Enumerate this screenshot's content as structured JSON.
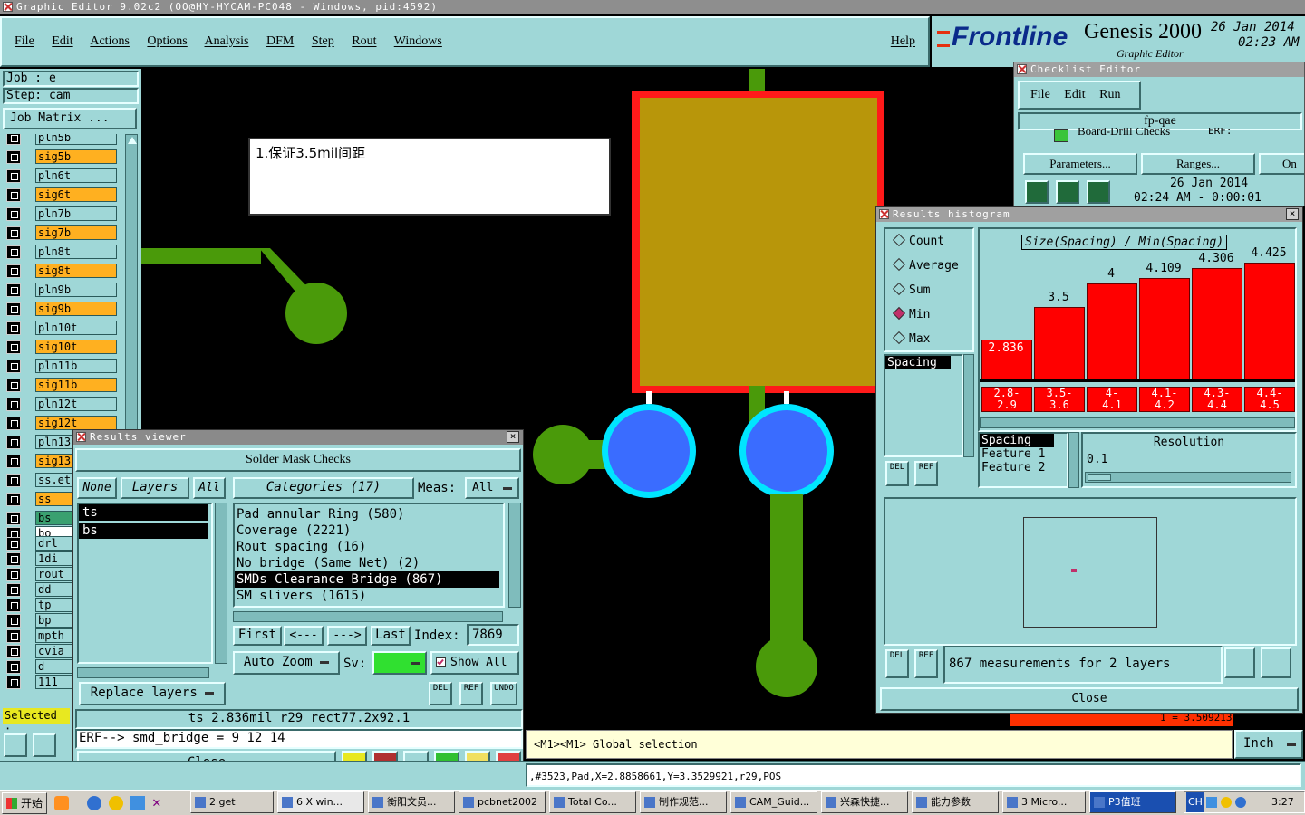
{
  "app": {
    "title": "Graphic Editor 9.02c2 (OO@HY-HYCAM-PC048 - Windows, pid:4592)",
    "brand": "Frontline",
    "product": "Genesis 2000",
    "subtitle": "Graphic Editor",
    "date": "26 Jan 2014",
    "time": "02:23 AM"
  },
  "menu": [
    "File",
    "Edit",
    "Actions",
    "Options",
    "Analysis",
    "DFM",
    "Step",
    "Rout",
    "Windows"
  ],
  "help_label": "Help",
  "job": {
    "job": "Job : e",
    "step": "Step: cam",
    "matrix": "Job Matrix ..."
  },
  "layers": [
    {
      "name": "pln5b",
      "sig": false
    },
    {
      "name": "sig5b",
      "sig": true
    },
    {
      "name": "pln6t",
      "sig": false
    },
    {
      "name": "sig6t",
      "sig": true
    },
    {
      "name": "pln7b",
      "sig": false
    },
    {
      "name": "sig7b",
      "sig": true
    },
    {
      "name": "pln8t",
      "sig": false
    },
    {
      "name": "sig8t",
      "sig": true
    },
    {
      "name": "pln9b",
      "sig": false
    },
    {
      "name": "sig9b",
      "sig": true
    },
    {
      "name": "pln10t",
      "sig": false
    },
    {
      "name": "sig10t",
      "sig": true
    },
    {
      "name": "pln11b",
      "sig": false
    },
    {
      "name": "sig11b",
      "sig": true
    },
    {
      "name": "pln12t",
      "sig": false
    },
    {
      "name": "sig12t",
      "sig": true
    },
    {
      "name": "pln13",
      "sig": false
    },
    {
      "name": "sig13",
      "sig": true
    },
    {
      "name": "ss.et",
      "sig": false
    },
    {
      "name": "ss",
      "sig": true
    },
    {
      "name": "bs",
      "sig": false,
      "green": true
    },
    {
      "name": "bo",
      "sig": false,
      "white": true
    },
    {
      "name": "drl",
      "sig": false
    },
    {
      "name": "1di",
      "sig": false
    },
    {
      "name": "rout",
      "sig": false
    },
    {
      "name": "dd",
      "sig": false
    },
    {
      "name": "tp",
      "sig": false
    },
    {
      "name": "bp",
      "sig": false
    },
    {
      "name": "mpth",
      "sig": false
    },
    {
      "name": "cvia",
      "sig": false
    },
    {
      "name": "d",
      "sig": false
    },
    {
      "name": "111",
      "sig": false
    }
  ],
  "selected_label": "Selected :",
  "annotation": "1.保证3.5mil间距",
  "results_viewer": {
    "title": "Results viewer",
    "header": "Solder Mask Checks",
    "none": "None",
    "layers": "Layers",
    "all": "All",
    "categories": "Categories (17)",
    "meas_label": "Meas:",
    "meas_value": "All",
    "layer_list": [
      "ts",
      "bs"
    ],
    "category_list": [
      "Pad annular Ring (580)",
      "Coverage (2221)",
      "Rout spacing (16)",
      "No bridge (Same Net) (2)",
      "SMDs Clearance Bridge (867)",
      "SM slivers (1615)"
    ],
    "selected_category": 4,
    "first": "First",
    "prev": "<---",
    "next": "--->",
    "last": "Last",
    "index_label": "Index:",
    "index_value": "7869",
    "auto_zoom": "Auto Zoom",
    "sv_label": "Sv:",
    "show_all": "Show All",
    "replace_layers": "Replace layers",
    "del": "DEL",
    "ref": "REF",
    "undo": "UNDO",
    "info": "ts 2.836mil  r29  rect77.2x92.1",
    "erf": "ERF--> smd_bridge = 9 12 14",
    "close": "Close"
  },
  "checklist": {
    "title": "Checklist Editor",
    "menu": [
      "File",
      "Edit",
      "Run"
    ],
    "name": "fp-qae",
    "row": "Board-Drill Checks",
    "erf": "ERF:",
    "parameters": "Parameters...",
    "ranges": "Ranges...",
    "other": "On",
    "date": "26 Jan 2014",
    "time": "02:24 AM - 0:00:01"
  },
  "histogram": {
    "title": "Results histogram",
    "modes": [
      "Count",
      "Average",
      "Sum",
      "Min",
      "Max"
    ],
    "selected_mode": 3,
    "measure_list": [
      "Spacing"
    ],
    "title_box": "Size(Spacing) / Min(Spacing)",
    "spacing_items": [
      "Spacing",
      "Feature 1",
      "Feature 2"
    ],
    "resolution_label": "Resolution",
    "resolution_value": "0.1",
    "summary": "867 measurements for 2 layers",
    "close": "Close",
    "del": "DEL",
    "ref": "REF",
    "footer_value": "1 = 3.509213"
  },
  "chart_data": {
    "type": "bar",
    "title": "Size(Spacing) / Min(Spacing)",
    "categories": [
      "2.8-2.9",
      "3.5-3.6",
      "4-4.1",
      "4.1-4.2",
      "4.3-4.4",
      "4.4-4.5"
    ],
    "values": [
      2.836,
      3.5,
      4,
      4.109,
      4.306,
      4.425
    ],
    "value_labels": [
      "2.836",
      "3.5",
      "4",
      "4.109",
      "4.306",
      "4.425"
    ],
    "bin_labels_top": [
      "2.8-",
      "3.5-",
      "4-",
      "4.1-",
      "4.3-",
      "4.4-"
    ],
    "bin_labels_bottom": [
      "2.9",
      "3.6",
      "4.1",
      "4.2",
      "4.4",
      "4.5"
    ],
    "ylim": [
      0,
      5
    ],
    "colors": {
      "bar": "#ff0000",
      "highlight_label": "#e01010"
    }
  },
  "status": {
    "message": "<M1><M1> Global selection",
    "unit": "Inch",
    "coords": ",#3523,Pad,X=2.8858661,Y=3.3529921,r29,POS"
  },
  "taskbar": {
    "start": "开始",
    "items": [
      "2 get",
      "6 X win...",
      "衡阳文员...",
      "pcbnet2002",
      "Total Co...",
      "制作规范...",
      "CAM_Guid...",
      "兴森快捷...",
      "能力参数",
      "3 Micro...",
      "P3值班"
    ],
    "lang": "CH",
    "clock": "3:27"
  },
  "colors": {
    "panel": "#9fd7d7",
    "copper": "#b8960a",
    "trace": "#4a9a0a",
    "pad": "#3a6cff",
    "pad_ring": "#00e5ff",
    "outline": "#ff1a1a"
  }
}
